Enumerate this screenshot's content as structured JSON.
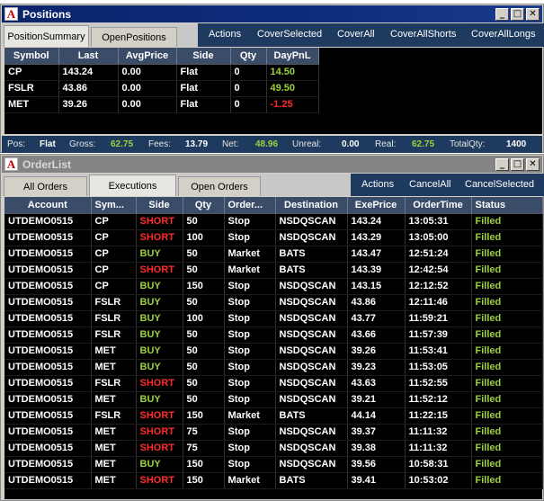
{
  "positions_window": {
    "title": "Positions",
    "tabs": [
      "PositionSummary",
      "OpenPositions"
    ],
    "actions": [
      "Actions",
      "CoverSelected",
      "CoverAll",
      "CoverAllShorts",
      "CoverAllLongs"
    ],
    "columns": [
      "Symbol",
      "Last",
      "AvgPrice",
      "Side",
      "Qty",
      "DayPnL"
    ],
    "rows": [
      {
        "symbol": "CP",
        "last": "143.24",
        "avg": "0.00",
        "side": "Flat",
        "qty": "0",
        "pnl": "14.50",
        "pnl_color": "green"
      },
      {
        "symbol": "FSLR",
        "last": "43.86",
        "avg": "0.00",
        "side": "Flat",
        "qty": "0",
        "pnl": "49.50",
        "pnl_color": "green"
      },
      {
        "symbol": "MET",
        "last": "39.26",
        "avg": "0.00",
        "side": "Flat",
        "qty": "0",
        "pnl": "-1.25",
        "pnl_color": "red"
      }
    ],
    "summary": {
      "pos_label": "Pos:",
      "pos_value": "Flat",
      "gross_label": "Gross:",
      "gross_value": "62.75",
      "fees_label": "Fees:",
      "fees_value": "13.79",
      "net_label": "Net:",
      "net_value": "48.96",
      "unreal_label": "Unreal:",
      "unreal_value": "0.00",
      "real_label": "Real:",
      "real_value": "62.75",
      "totalqty_label": "TotalQty:",
      "totalqty_value": "1400"
    }
  },
  "orders_window": {
    "title": "OrderList",
    "tabs": [
      "All Orders",
      "Executions",
      "Open Orders"
    ],
    "actions": [
      "Actions",
      "CancelAll",
      "CancelSelected"
    ],
    "columns": [
      "Account",
      "Sym...",
      "Side",
      "Qty",
      "Order...",
      "Destination",
      "ExePrice",
      "OrderTime",
      "Status"
    ],
    "rows": [
      {
        "account": "UTDEMO0515",
        "sym": "CP",
        "side": "SHORT",
        "qty": "50",
        "type": "Stop",
        "dest": "NSDQSCAN",
        "price": "143.24",
        "time": "13:05:31",
        "status": "Filled"
      },
      {
        "account": "UTDEMO0515",
        "sym": "CP",
        "side": "SHORT",
        "qty": "100",
        "type": "Stop",
        "dest": "NSDQSCAN",
        "price": "143.29",
        "time": "13:05:00",
        "status": "Filled"
      },
      {
        "account": "UTDEMO0515",
        "sym": "CP",
        "side": "BUY",
        "qty": "50",
        "type": "Market",
        "dest": "BATS",
        "price": "143.47",
        "time": "12:51:24",
        "status": "Filled"
      },
      {
        "account": "UTDEMO0515",
        "sym": "CP",
        "side": "SHORT",
        "qty": "50",
        "type": "Market",
        "dest": "BATS",
        "price": "143.39",
        "time": "12:42:54",
        "status": "Filled"
      },
      {
        "account": "UTDEMO0515",
        "sym": "CP",
        "side": "BUY",
        "qty": "150",
        "type": "Stop",
        "dest": "NSDQSCAN",
        "price": "143.15",
        "time": "12:12:52",
        "status": "Filled"
      },
      {
        "account": "UTDEMO0515",
        "sym": "FSLR",
        "side": "BUY",
        "qty": "50",
        "type": "Stop",
        "dest": "NSDQSCAN",
        "price": "43.86",
        "time": "12:11:46",
        "status": "Filled"
      },
      {
        "account": "UTDEMO0515",
        "sym": "FSLR",
        "side": "BUY",
        "qty": "100",
        "type": "Stop",
        "dest": "NSDQSCAN",
        "price": "43.77",
        "time": "11:59:21",
        "status": "Filled"
      },
      {
        "account": "UTDEMO0515",
        "sym": "FSLR",
        "side": "BUY",
        "qty": "50",
        "type": "Stop",
        "dest": "NSDQSCAN",
        "price": "43.66",
        "time": "11:57:39",
        "status": "Filled"
      },
      {
        "account": "UTDEMO0515",
        "sym": "MET",
        "side": "BUY",
        "qty": "50",
        "type": "Stop",
        "dest": "NSDQSCAN",
        "price": "39.26",
        "time": "11:53:41",
        "status": "Filled"
      },
      {
        "account": "UTDEMO0515",
        "sym": "MET",
        "side": "BUY",
        "qty": "50",
        "type": "Stop",
        "dest": "NSDQSCAN",
        "price": "39.23",
        "time": "11:53:05",
        "status": "Filled"
      },
      {
        "account": "UTDEMO0515",
        "sym": "FSLR",
        "side": "SHORT",
        "qty": "50",
        "type": "Stop",
        "dest": "NSDQSCAN",
        "price": "43.63",
        "time": "11:52:55",
        "status": "Filled"
      },
      {
        "account": "UTDEMO0515",
        "sym": "MET",
        "side": "BUY",
        "qty": "50",
        "type": "Stop",
        "dest": "NSDQSCAN",
        "price": "39.21",
        "time": "11:52:12",
        "status": "Filled"
      },
      {
        "account": "UTDEMO0515",
        "sym": "FSLR",
        "side": "SHORT",
        "qty": "150",
        "type": "Market",
        "dest": "BATS",
        "price": "44.14",
        "time": "11:22:15",
        "status": "Filled"
      },
      {
        "account": "UTDEMO0515",
        "sym": "MET",
        "side": "SHORT",
        "qty": "75",
        "type": "Stop",
        "dest": "NSDQSCAN",
        "price": "39.37",
        "time": "11:11:32",
        "status": "Filled"
      },
      {
        "account": "UTDEMO0515",
        "sym": "MET",
        "side": "SHORT",
        "qty": "75",
        "type": "Stop",
        "dest": "NSDQSCAN",
        "price": "39.38",
        "time": "11:11:32",
        "status": "Filled"
      },
      {
        "account": "UTDEMO0515",
        "sym": "MET",
        "side": "BUY",
        "qty": "150",
        "type": "Stop",
        "dest": "NSDQSCAN",
        "price": "39.56",
        "time": "10:58:31",
        "status": "Filled"
      },
      {
        "account": "UTDEMO0515",
        "sym": "MET",
        "side": "SHORT",
        "qty": "150",
        "type": "Market",
        "dest": "BATS",
        "price": "39.41",
        "time": "10:53:02",
        "status": "Filled"
      }
    ]
  },
  "colors": {
    "buy": "#9bd23c",
    "short": "#ff2b2b",
    "filled": "#9bd23c",
    "header_bg": "#3a4c68",
    "action_bar": "#1e3a5e"
  },
  "icons": {
    "app": "app-logo-icon",
    "minimize": "minimize-icon",
    "maximize": "maximize-icon",
    "close": "close-icon"
  }
}
